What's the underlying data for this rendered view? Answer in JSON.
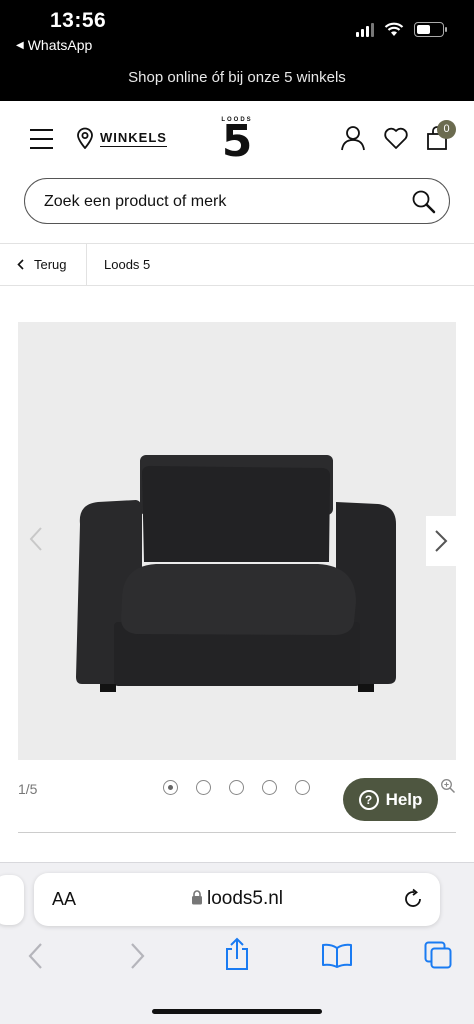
{
  "status": {
    "time": "13:56",
    "back_app": "WhatsApp"
  },
  "promo": {
    "text": "Shop online óf bij onze 5 winkels"
  },
  "header": {
    "stores_label": "WINKELS",
    "logo_small": "LOODS",
    "logo_big": "5",
    "cart_count": "0"
  },
  "search": {
    "placeholder": "Zoek een product of merk"
  },
  "breadcrumb": {
    "back_label": "Terug",
    "current": "Loods 5"
  },
  "gallery": {
    "counter": "1/5",
    "total_images": 5,
    "active_index": 1
  },
  "help": {
    "label": "Help"
  },
  "browser": {
    "text_size_label": "AA",
    "url": "loods5.nl"
  },
  "colors": {
    "help_bg": "#4e5640",
    "badge_bg": "#6b6b4f",
    "safari_blue": "#1a7bf2"
  }
}
